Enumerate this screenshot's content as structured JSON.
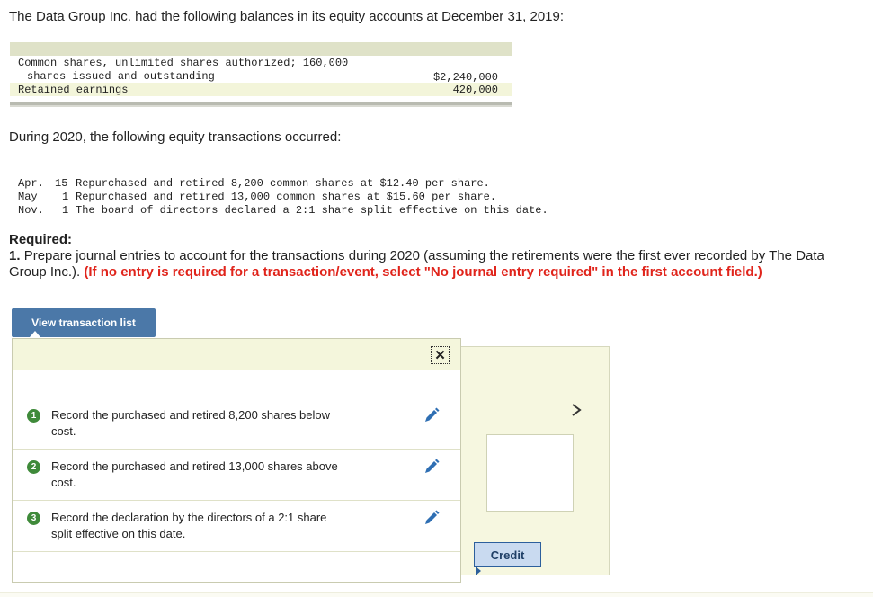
{
  "intro": "The Data Group Inc. had the following balances in its equity accounts at December 31, 2019:",
  "balances": {
    "rows": [
      {
        "label_line1": "Common shares, unlimited shares authorized; 160,000",
        "label_line2": "shares issued and outstanding",
        "value": "$2,240,000"
      },
      {
        "label_line1": "Retained earnings",
        "value": "420,000"
      }
    ]
  },
  "during": "During 2020, the following equity transactions occurred:",
  "transactions": [
    {
      "month": "Apr.",
      "day": "15",
      "text": "Repurchased and retired 8,200 common shares at $12.40 per share."
    },
    {
      "month": "May",
      "day": "1",
      "text": "Repurchased and retired 13,000 common shares at $15.60 per share."
    },
    {
      "month": "Nov.",
      "day": "1",
      "text": "The board of directors declared a 2:1 share split effective on this date."
    }
  ],
  "required": {
    "title": "Required:",
    "number": "1.",
    "text": "Prepare journal entries to account for the transactions during 2020 (assuming the retirements were the first ever recorded by The Data Group Inc.).",
    "note": "(If no entry is required for a transaction/event, select \"No journal entry required\" in the first account field.)"
  },
  "view_button": "View transaction list",
  "list_items": [
    {
      "num": "1",
      "line1": "Record the purchased and retired 8,200 shares below",
      "line2": "cost."
    },
    {
      "num": "2",
      "line1": "Record the purchased and retired 13,000 shares above",
      "line2": "cost."
    },
    {
      "num": "3",
      "line1": "Record the declaration by the directors of a 2:1 share",
      "line2": "split effective on this date."
    }
  ],
  "journal": {
    "credit_header": "Credit",
    "next_glyph": ">"
  },
  "close_glyph": "✕",
  "colors": {
    "button": "#4b78a8",
    "accent_red": "#e0241b",
    "step_green": "#3f8a3a",
    "pencil_blue": "#2f6fb3"
  }
}
